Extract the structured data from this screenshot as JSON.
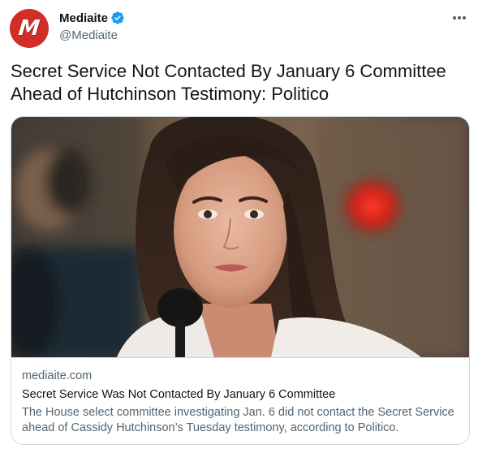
{
  "author": {
    "display_name": "Mediaite",
    "handle": "@Mediaite",
    "avatar_letter": "M",
    "avatar_color": "#d12e27",
    "verified": true,
    "verified_color": "#1d9bf0"
  },
  "tweet": {
    "text": "Secret Service Not Contacted By January 6 Committee Ahead of Hutchinson Testimony: Politico"
  },
  "card": {
    "domain": "mediaite.com",
    "title": "Secret Service Was Not Contacted By January 6 Committee",
    "description": "The House select committee investigating Jan. 6 did not contact the Secret Service ahead of Cassidy Hutchinson’s Tuesday testimony, according to Politico."
  },
  "icons": {
    "verified": "verified-badge-icon",
    "more": "more-options-icon"
  }
}
